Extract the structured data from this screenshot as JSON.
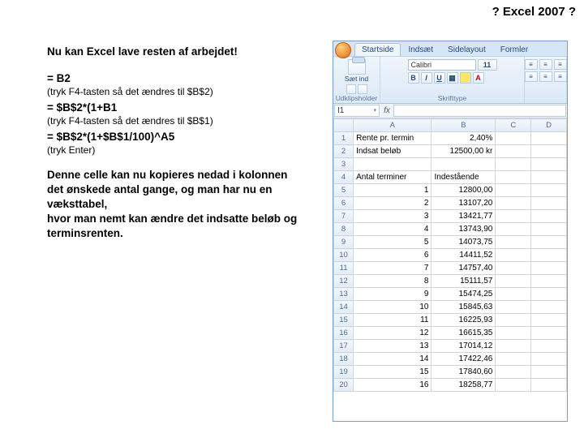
{
  "title": "? Excel 2007 ?",
  "left": {
    "intro": "Nu kan Excel lave resten af arbejdet!",
    "formula1": "= B2",
    "hint1": "(tryk F4-tasten så det ændres til $B$2)",
    "formula2": "= $B$2*(1+B1",
    "hint2": "(tryk F4-tasten så det ændres til $B$1)",
    "formula3": "= $B$2*(1+$B$1/100)^A5",
    "hint3": "(tryk Enter)",
    "copy1": "Denne celle kan nu kopieres nedad i kolonnen det ønskede antal gange, og man har nu en væksttabel,",
    "copy2": "hvor man nemt kan ændre det indsatte beløb og terminsrenten."
  },
  "excel": {
    "tabs": [
      "Startside",
      "Indsæt",
      "Sidelayout",
      "Formler"
    ],
    "group_clip": "Udklipsholder",
    "group_font": "Skrifttype",
    "paste_label": "Sæt ind",
    "font_name": "Calibri",
    "font_size": "11",
    "name_box": "I1",
    "columns": [
      "A",
      "B",
      "C",
      "D"
    ],
    "rows": [
      {
        "n": 1,
        "a": "Rente pr. termin",
        "b": "2,40%"
      },
      {
        "n": 2,
        "a": "Indsat beløb",
        "b": "12500,00 kr"
      },
      {
        "n": 3,
        "a": "",
        "b": ""
      },
      {
        "n": 4,
        "a": "Antal terminer",
        "b": "Indestående"
      },
      {
        "n": 5,
        "a": "1",
        "b": "12800,00"
      },
      {
        "n": 6,
        "a": "2",
        "b": "13107,20"
      },
      {
        "n": 7,
        "a": "3",
        "b": "13421,77"
      },
      {
        "n": 8,
        "a": "4",
        "b": "13743,90"
      },
      {
        "n": 9,
        "a": "5",
        "b": "14073,75"
      },
      {
        "n": 10,
        "a": "6",
        "b": "14411,52"
      },
      {
        "n": 11,
        "a": "7",
        "b": "14757,40"
      },
      {
        "n": 12,
        "a": "8",
        "b": "15111,57"
      },
      {
        "n": 13,
        "a": "9",
        "b": "15474,25"
      },
      {
        "n": 14,
        "a": "10",
        "b": "15845,63"
      },
      {
        "n": 15,
        "a": "11",
        "b": "16225,93"
      },
      {
        "n": 16,
        "a": "12",
        "b": "16615,35"
      },
      {
        "n": 17,
        "a": "13",
        "b": "17014,12"
      },
      {
        "n": 18,
        "a": "14",
        "b": "17422,46"
      },
      {
        "n": 19,
        "a": "15",
        "b": "17840,60"
      },
      {
        "n": 20,
        "a": "16",
        "b": "18258,77"
      }
    ]
  }
}
